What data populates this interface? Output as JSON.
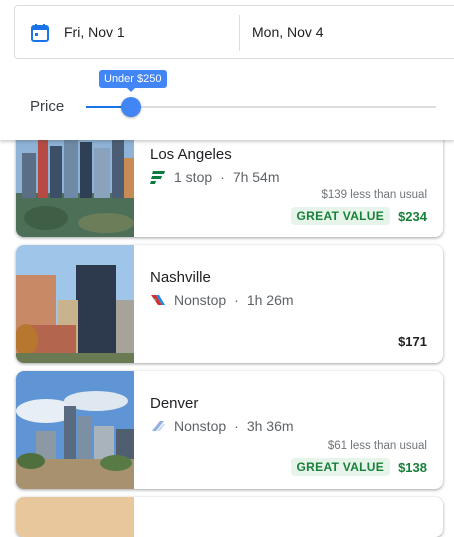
{
  "dates": {
    "start": "Fri, Nov 1",
    "end": "Mon, Nov 4"
  },
  "price_filter": {
    "label": "Price",
    "tooltip": "Under $250",
    "slider_fraction": 0.13
  },
  "colors": {
    "accent": "#4285f4",
    "good_value": "#188038",
    "badge_bg": "#e6f4ea"
  },
  "results": [
    {
      "city": "Los Angeles",
      "stops": "1 stop",
      "duration": "7h 54m",
      "saving": "$139 less than usual",
      "badge": "GREAT VALUE",
      "price": "$234",
      "airline_icon": "frontier-airline-icon"
    },
    {
      "city": "Nashville",
      "stops": "Nonstop",
      "duration": "1h 26m",
      "price": "$171",
      "airline_icon": "american-airlines-icon"
    },
    {
      "city": "Denver",
      "stops": "Nonstop",
      "duration": "3h 36m",
      "saving": "$61 less than usual",
      "badge": "GREAT VALUE",
      "price": "$138",
      "airline_icon": "united-airline-icon"
    }
  ]
}
